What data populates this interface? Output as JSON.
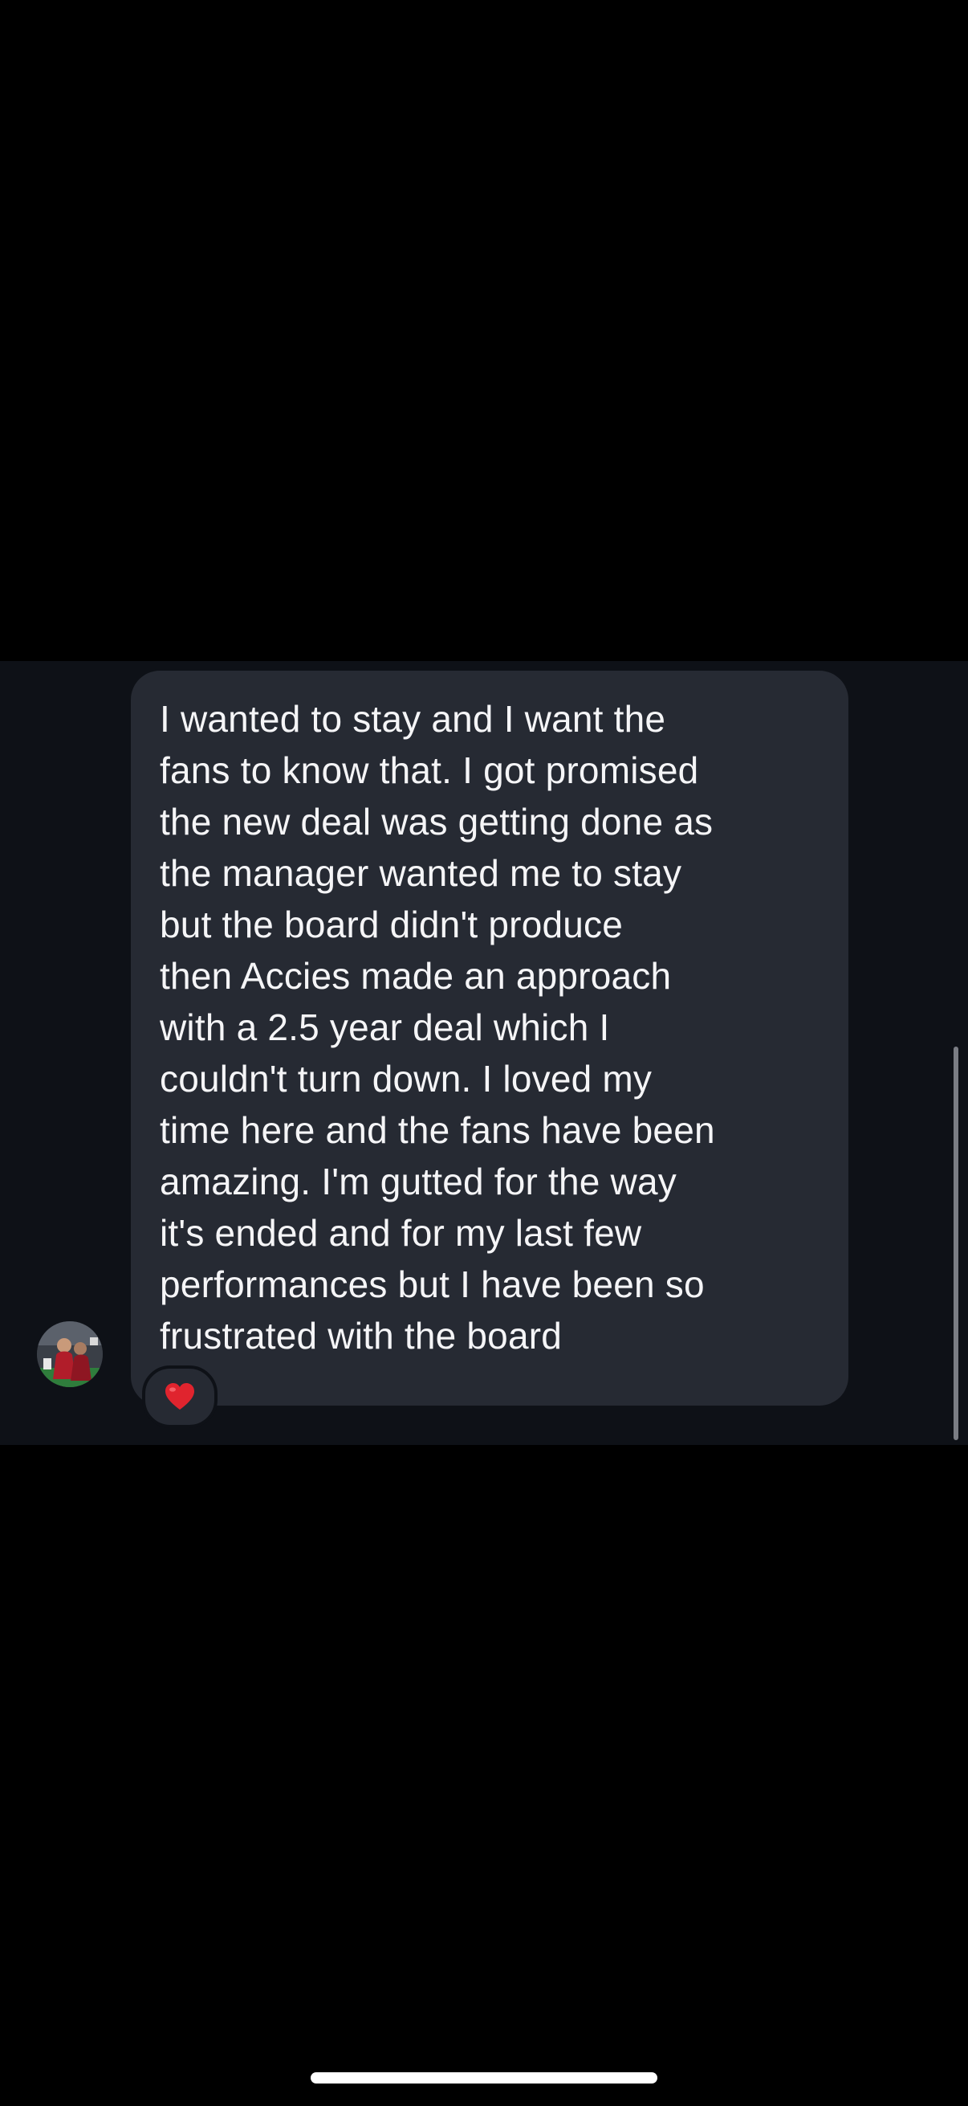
{
  "message": {
    "lines": [
      "I wanted to stay and I want the",
      "fans to know that. I got promised",
      "the new deal was getting done as",
      "the manager wanted me to stay",
      "but the board didn't produce",
      "then Accies made an approach",
      "with a 2.5 year deal which I",
      "couldn't turn down. I loved my",
      "time here and the fans have been",
      "amazing. I'm gutted for the way",
      "it's ended and for my last few",
      "performances but I have been so",
      "frustrated with the board"
    ],
    "reaction_icon": "red-heart-icon"
  },
  "sender": {
    "avatar_icon": "avatar-photo"
  },
  "colors": {
    "background": "#000000",
    "chat_background": "#0e1117",
    "bubble": "#262a33",
    "text": "#f5f5f7",
    "heart": "#e0242e"
  }
}
